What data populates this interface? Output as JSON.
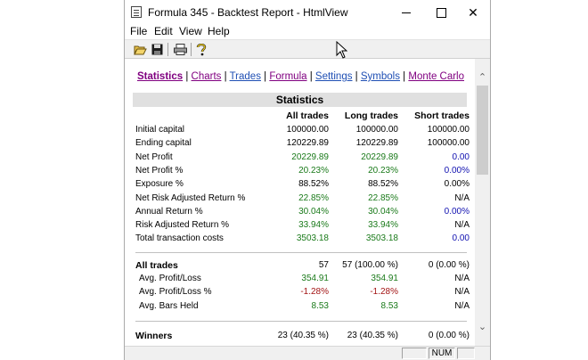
{
  "window": {
    "title": "Formula 345 - Backtest Report - HtmlView"
  },
  "menu": [
    "File",
    "Edit",
    "View",
    "Help"
  ],
  "toolbar_icons": [
    "open-folder-icon",
    "save-icon",
    "print-icon",
    "help-icon"
  ],
  "nav": [
    {
      "label": "Statistics",
      "state": "active"
    },
    {
      "label": "Charts",
      "state": "visited"
    },
    {
      "label": "Trades",
      "state": "link"
    },
    {
      "label": "Formula",
      "state": "visited"
    },
    {
      "label": "Settings",
      "state": "link"
    },
    {
      "label": "Symbols",
      "state": "link"
    },
    {
      "label": "Monte Carlo",
      "state": "visited"
    }
  ],
  "section_title": "Statistics",
  "columns": [
    "All trades",
    "Long trades",
    "Short trades"
  ],
  "rows": [
    {
      "label": "Initial capital",
      "all": "100000.00",
      "long": "100000.00",
      "short": "100000.00",
      "colors": [
        "k",
        "k",
        "k"
      ]
    },
    {
      "label": "Ending capital",
      "all": "120229.89",
      "long": "120229.89",
      "short": "100000.00",
      "colors": [
        "k",
        "k",
        "k"
      ]
    },
    {
      "label": "Net Profit",
      "all": "20229.89",
      "long": "20229.89",
      "short": "0.00",
      "colors": [
        "g",
        "g",
        "b"
      ]
    },
    {
      "label": "Net Profit %",
      "all": "20.23%",
      "long": "20.23%",
      "short": "0.00%",
      "colors": [
        "g",
        "g",
        "b"
      ]
    },
    {
      "label": "Exposure %",
      "all": "88.52%",
      "long": "88.52%",
      "short": "0.00%",
      "colors": [
        "k",
        "k",
        "k"
      ]
    },
    {
      "label": "Net Risk Adjusted Return %",
      "all": "22.85%",
      "long": "22.85%",
      "short": "N/A",
      "colors": [
        "g",
        "g",
        "k"
      ]
    },
    {
      "label": "Annual Return %",
      "all": "30.04%",
      "long": "30.04%",
      "short": "0.00%",
      "colors": [
        "g",
        "g",
        "b"
      ]
    },
    {
      "label": "Risk Adjusted Return %",
      "all": "33.94%",
      "long": "33.94%",
      "short": "N/A",
      "colors": [
        "g",
        "g",
        "k"
      ]
    },
    {
      "label": "Total transaction costs",
      "all": "3503.18",
      "long": "3503.18",
      "short": "0.00",
      "colors": [
        "g",
        "g",
        "b"
      ]
    }
  ],
  "all_trades": {
    "label": "All trades",
    "all": "57",
    "long": "57 (100.00 %)",
    "short": "0 (0.00 %)",
    "rows": [
      {
        "label": "Avg. Profit/Loss",
        "all": "354.91",
        "long": "354.91",
        "short": "N/A",
        "colors": [
          "g",
          "g",
          "k"
        ]
      },
      {
        "label": "Avg. Profit/Loss %",
        "all": "-1.28%",
        "long": "-1.28%",
        "short": "N/A",
        "colors": [
          "r",
          "r",
          "k"
        ]
      },
      {
        "label": "Avg. Bars Held",
        "all": "8.53",
        "long": "8.53",
        "short": "N/A",
        "colors": [
          "g",
          "g",
          "k"
        ]
      }
    ]
  },
  "winners": {
    "label": "Winners",
    "all": "23 (40.35 %)",
    "long": "23 (40.35 %)",
    "short": "0 (0.00 %)"
  },
  "status": {
    "num": "NUM"
  }
}
